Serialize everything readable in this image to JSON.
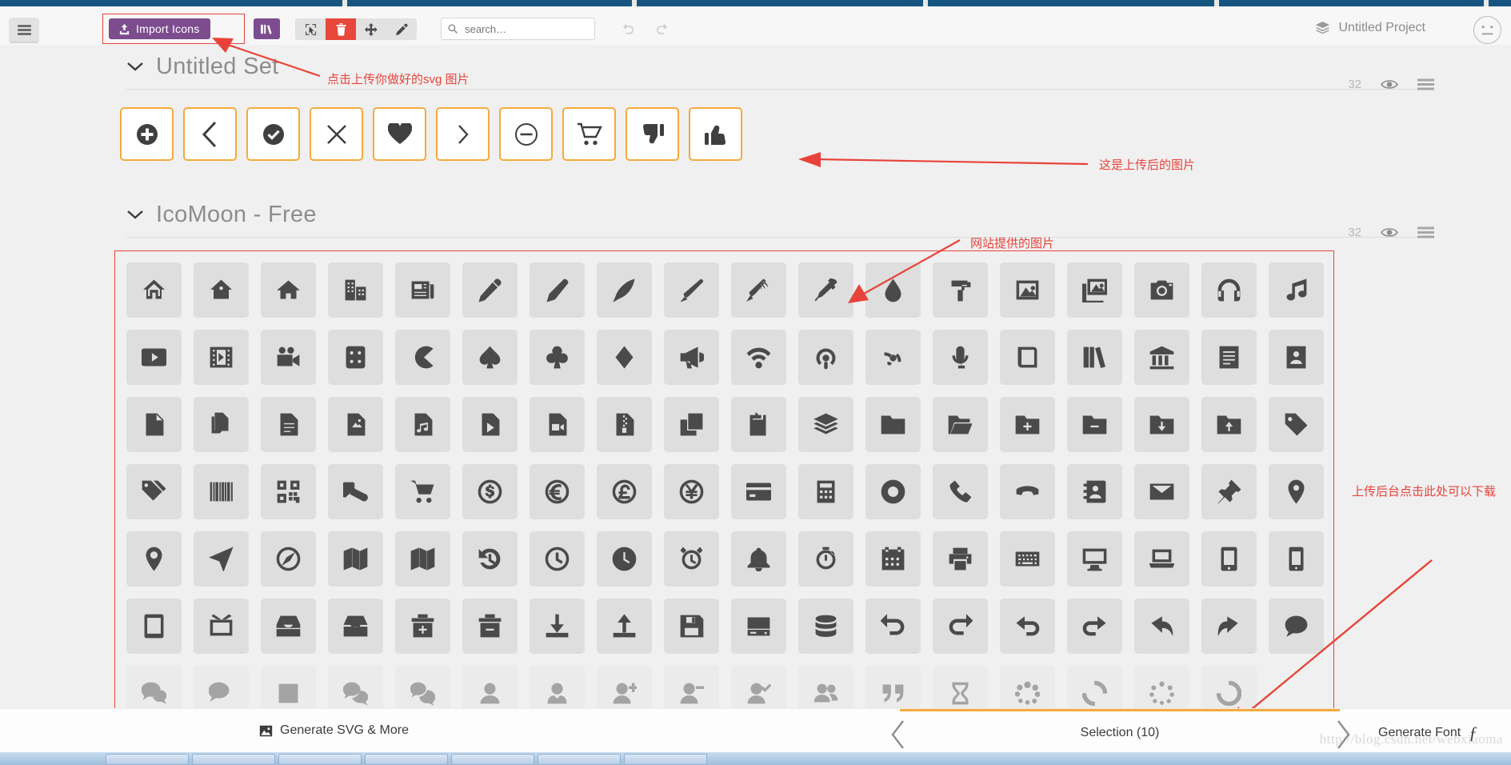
{
  "app": {
    "project_name": "Untitled Project",
    "project_icon": "layers-icon"
  },
  "toolbar": {
    "menu_icon": "hamburger-icon",
    "import_label": "Import Icons",
    "import_icon": "upload-icon",
    "library_icon": "library-icon",
    "tools": [
      {
        "name": "select-tool",
        "icon": "cursor-select-icon",
        "active": false
      },
      {
        "name": "delete-tool",
        "icon": "trash-icon",
        "active": true
      },
      {
        "name": "move-tool",
        "icon": "move-arrows-icon",
        "active": false
      },
      {
        "name": "edit-tool",
        "icon": "pencil-icon",
        "active": false
      }
    ],
    "search": {
      "placeholder": "search…",
      "value": "",
      "icon": "search-icon"
    },
    "undo_icon": "undo-icon",
    "redo_icon": "redo-icon"
  },
  "sets": [
    {
      "title": "Untitled Set",
      "count": "32",
      "eye_icon": "eye-icon",
      "menu_icon": "list-menu-icon",
      "chevron_icon": "chevron-down-icon",
      "icons": [
        "plus-circle-icon",
        "chevron-left-icon",
        "check-circle-icon",
        "close-x-icon",
        "heart-icon",
        "chevron-right-icon",
        "minus-circle-icon",
        "shopping-cart-icon",
        "thumbs-down-icon",
        "thumbs-up-icon"
      ]
    },
    {
      "title": "IcoMoon - Free",
      "count": "32",
      "eye_icon": "eye-icon",
      "menu_icon": "list-menu-icon",
      "chevron_icon": "chevron-down-icon",
      "icons": [
        "home-icon",
        "home2-icon",
        "home3-icon",
        "office-icon",
        "newspaper-icon",
        "pencil-icon",
        "pencil2-icon",
        "quill-icon",
        "pen-icon",
        "blog-icon",
        "eyedropper-icon",
        "droplet-icon",
        "paint-format-icon",
        "image-icon",
        "images-icon",
        "camera-icon",
        "headphones-icon",
        "music-icon",
        "play-icon",
        "film-icon",
        "video-camera-icon",
        "dice-icon",
        "pacman-icon",
        "spades-icon",
        "clubs-icon",
        "diamonds-icon",
        "bullhorn-icon",
        "connection-icon",
        "podcast-icon",
        "feed-icon",
        "mic-icon",
        "book-icon",
        "books-icon",
        "library-icon",
        "file-text-icon",
        "profile-icon",
        "file-empty-icon",
        "files-empty-icon",
        "file-text2-icon",
        "file-picture-icon",
        "file-music-icon",
        "file-play-icon",
        "file-video-icon",
        "file-zip-icon",
        "copy-icon",
        "paste-icon",
        "stack-icon",
        "folder-icon",
        "folder-open-icon",
        "folder-plus-icon",
        "folder-minus-icon",
        "folder-download-icon",
        "folder-upload-icon",
        "price-tag-icon",
        "price-tags-icon",
        "barcode-icon",
        "qrcode-icon",
        "ticket-icon",
        "cart-icon",
        "coin-dollar-icon",
        "coin-euro-icon",
        "coin-pound-icon",
        "coin-yen-icon",
        "credit-card-icon",
        "calculator-icon",
        "lifebuoy-icon",
        "phone-icon",
        "phone-hang-up-icon",
        "address-book-icon",
        "envelop-icon",
        "pushpin-icon",
        "location-icon",
        "location2-icon",
        "compass-icon",
        "compass2-icon",
        "map-icon",
        "map2-icon",
        "history-icon",
        "clock-icon",
        "clock2-icon",
        "alarm-icon",
        "bell-icon",
        "stopwatch-icon",
        "calendar-icon",
        "printer-icon",
        "keyboard-icon",
        "display-icon",
        "laptop-icon",
        "mobile-icon",
        "mobile2-icon",
        "tablet-icon",
        "tv-icon",
        "drawer-icon",
        "drawer2-icon",
        "box-add-icon",
        "box-remove-icon",
        "download-icon",
        "upload-icon",
        "floppy-disk-icon",
        "drive-icon",
        "database-icon",
        "undo-icon",
        "redo-icon",
        "undo2-icon",
        "redo2-icon",
        "forward-icon",
        "reply-icon",
        "bubble-icon",
        "bubbles-icon",
        "bubbles2-icon",
        "bubble2-icon",
        "bubbles3-icon",
        "bubbles4-icon",
        "user-icon",
        "user-tie-icon",
        "user-plus-icon",
        "user-minus-icon",
        "user-check-icon",
        "users-icon",
        "quotes-icon",
        "hour-glass-icon",
        "spinner-icon",
        "spinner2-icon",
        "spinner3-icon",
        "spinner4-icon"
      ]
    }
  ],
  "footer": {
    "generate_svg_label": "Generate SVG & More",
    "generate_svg_icon": "image-icon",
    "selection_label": "Selection (10)",
    "prev_icon": "chevron-left-icon",
    "next_icon": "chevron-right-icon",
    "generate_font_label": "Generate Font",
    "generate_font_icon": "font-f-icon",
    "watermark": "http://blog.csdn.net/webxiaoma"
  },
  "annotations": [
    {
      "name": "annotation-import",
      "text": "点击上传你做好的svg 图片"
    },
    {
      "name": "annotation-uploaded",
      "text": "这是上传后的图片"
    },
    {
      "name": "annotation-provided",
      "text": "网站提供的图片"
    },
    {
      "name": "annotation-download",
      "text": "上传后台点击此处可以下载"
    }
  ],
  "colors": {
    "accent_purple": "#7d4c8f",
    "annotation_red": "#e8433a",
    "upload_border": "#f5aa3c",
    "danger": "#e8473c",
    "browser_blue": "#15557f"
  }
}
